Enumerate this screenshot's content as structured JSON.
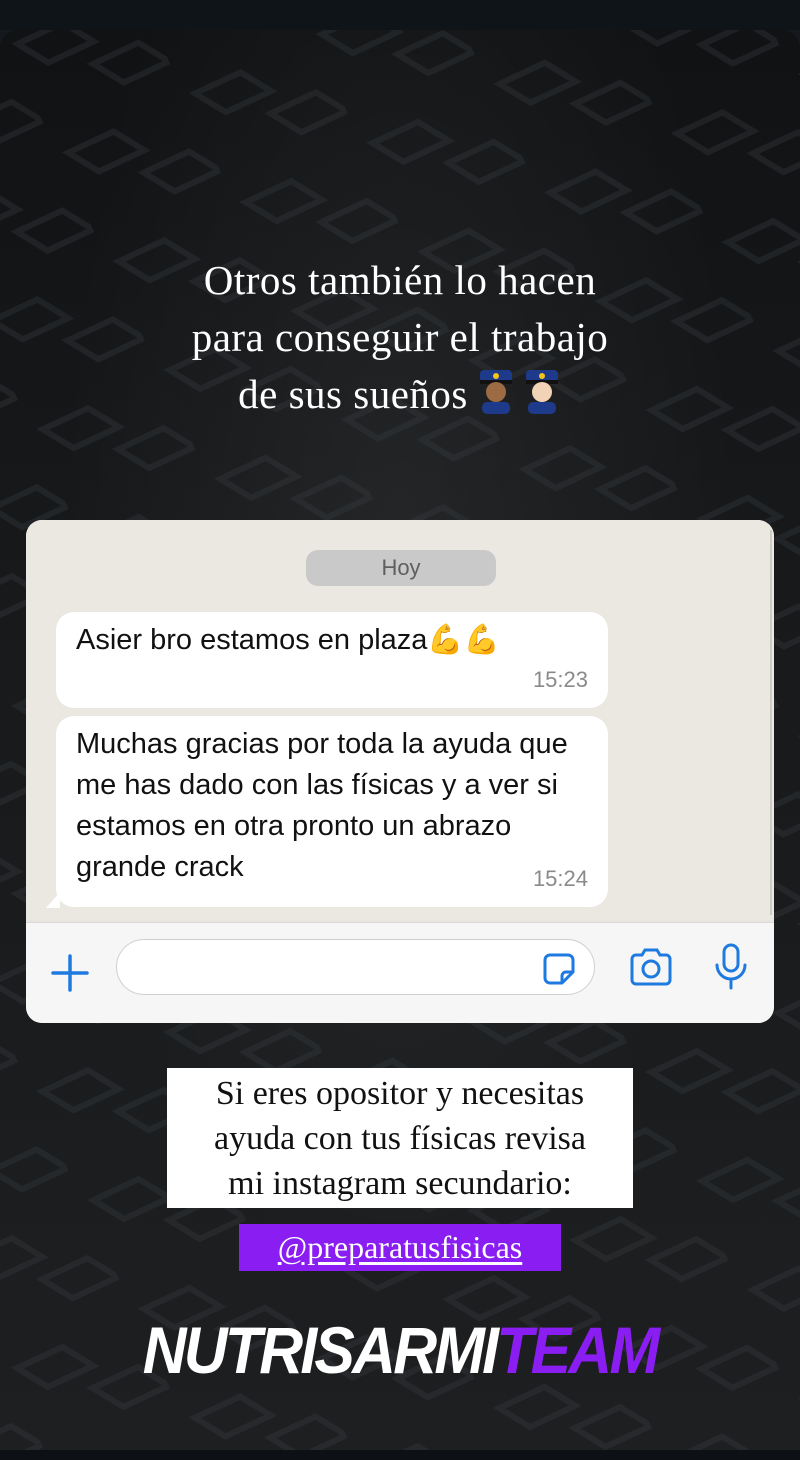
{
  "story": {
    "headline_lines": [
      "Otros también lo hacen",
      "para conseguir el trabajo",
      "de sus sueños"
    ]
  },
  "chat": {
    "date_label": "Hoy",
    "messages": [
      {
        "text": "Asier bro estamos en plaza💪💪",
        "time": "15:23"
      },
      {
        "text": "Muchas gracias por toda la ayuda que me has dado con las físicas y a ver si estamos en otra pronto un abrazo grande crack",
        "time": "15:24"
      }
    ],
    "input_placeholder": ""
  },
  "promo": {
    "lines": [
      "Si eres opositor y necesitas",
      "ayuda con tus físicas revisa",
      "mi instagram secundario:"
    ],
    "handle": "@preparatusfisicas"
  },
  "brand": {
    "part1": "NUTRISARMI",
    "part2": "TEAM",
    "accent_color": "#8a1ef2"
  },
  "icons": [
    "police-officer-emoji",
    "plus-icon",
    "sticker-icon",
    "camera-icon",
    "microphone-icon"
  ]
}
